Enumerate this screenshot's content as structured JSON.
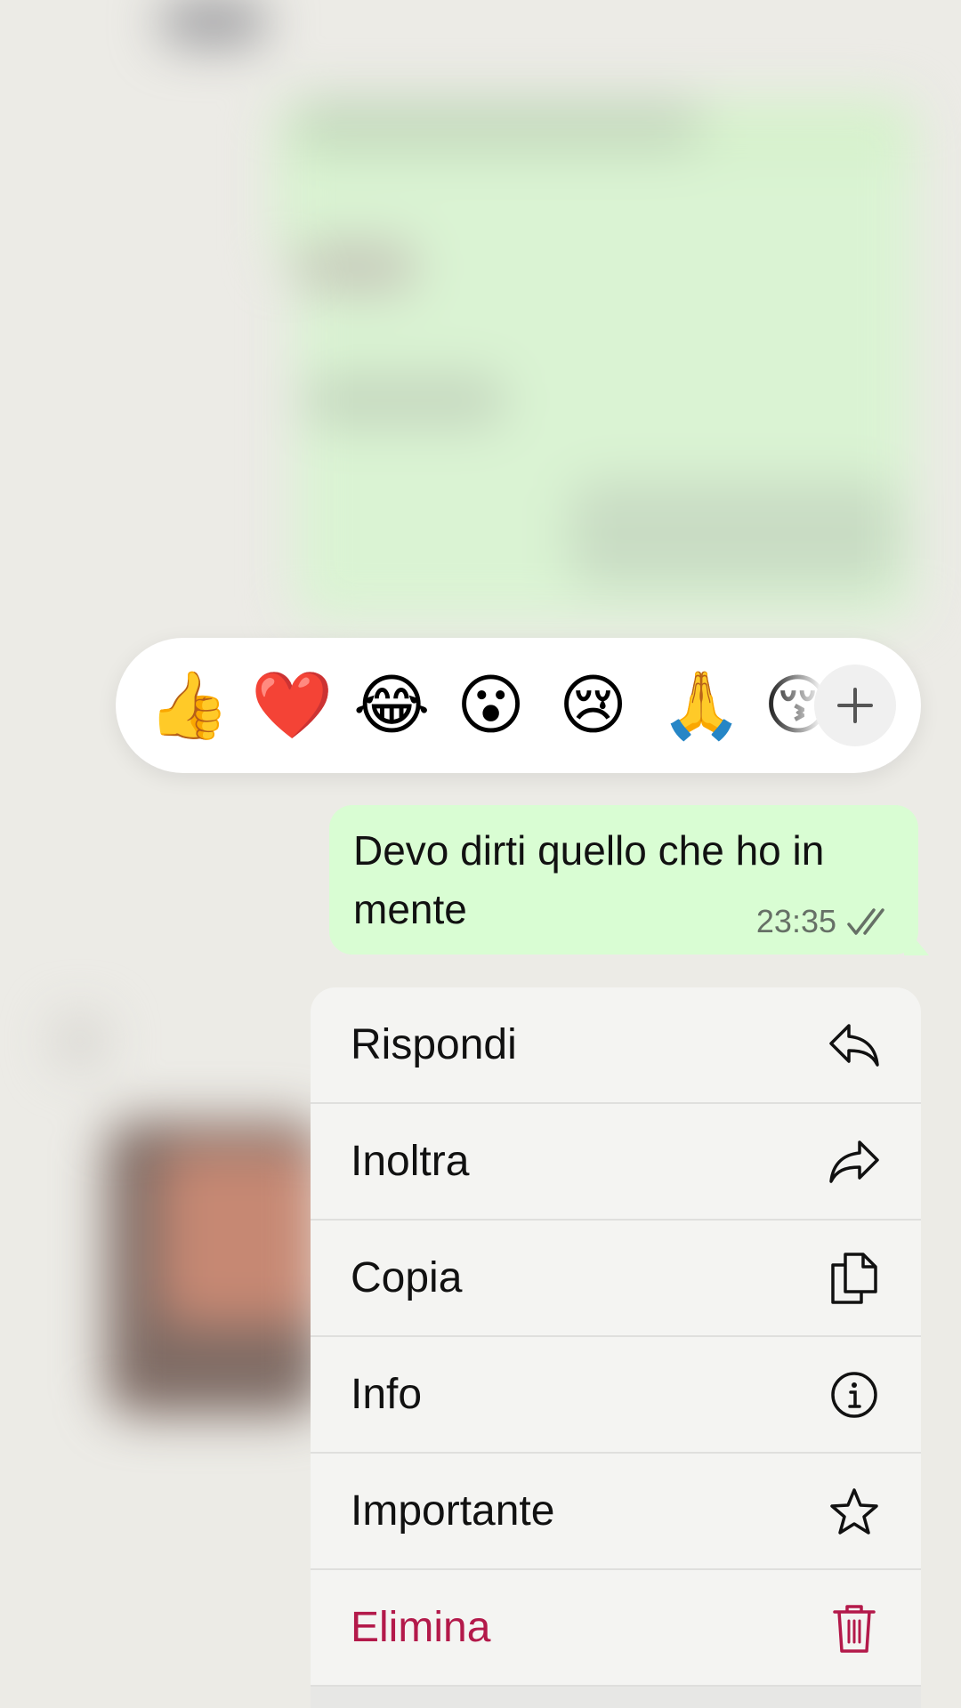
{
  "reactions": {
    "emojis": [
      "👍",
      "❤️",
      "😂",
      "😮",
      "😢",
      "🙏",
      "😚"
    ],
    "more_icon": "plus-icon"
  },
  "message": {
    "text": "Devo dirti quello che ho in mente",
    "time": "23:35",
    "status_icon": "double-check-icon",
    "bubble_color": "#d9fdd3"
  },
  "menu": {
    "items": [
      {
        "label": "Rispondi",
        "icon": "reply-icon"
      },
      {
        "label": "Inoltra",
        "icon": "forward-icon"
      },
      {
        "label": "Copia",
        "icon": "copy-icon"
      },
      {
        "label": "Info",
        "icon": "info-icon"
      },
      {
        "label": "Importante",
        "icon": "star-icon"
      },
      {
        "label": "Elimina",
        "icon": "trash-icon",
        "color": "#b3194a"
      }
    ]
  }
}
